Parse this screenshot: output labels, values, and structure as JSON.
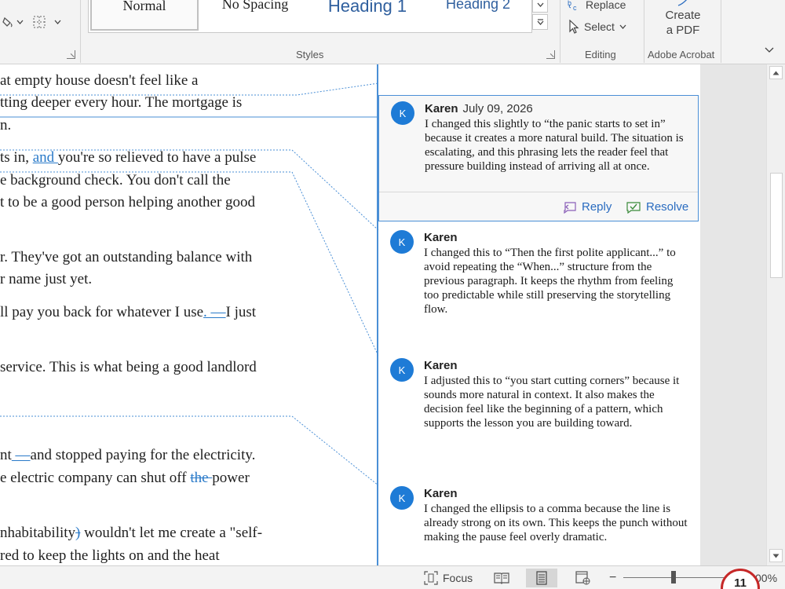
{
  "ribbon": {
    "styles_gallery": {
      "items": [
        "Normal",
        "No Spacing",
        "Heading 1",
        "Heading 2"
      ]
    },
    "groups": {
      "styles": "Styles",
      "editing": "Editing",
      "adobe": "Adobe Acrobat"
    },
    "editing": {
      "replace": "Replace",
      "select": "Select"
    },
    "adobe": {
      "create_pdf_line1": "Create",
      "create_pdf_line2": "a PDF"
    }
  },
  "document": {
    "lines": [
      {
        "parts": [
          {
            "t": "at empty house doesn't feel like a",
            "k": "n"
          }
        ]
      },
      {
        "parts": [
          {
            "t": "tting deeper every hour. The mortgage is",
            "k": "n"
          }
        ]
      },
      {
        "parts": [
          {
            "t": "n.",
            "k": "n"
          }
        ]
      },
      {
        "parts": [
          {
            "t": "ts in, ",
            "k": "n"
          },
          {
            "t": "and ",
            "k": "ins"
          },
          {
            "t": "you're so relieved to have a pulse",
            "k": "n"
          }
        ]
      },
      {
        "parts": [
          {
            "t": "e background check. You don't call the",
            "k": "n"
          }
        ]
      },
      {
        "parts": [
          {
            "t": "t to be a good person helping another good",
            "k": "n"
          }
        ]
      },
      {
        "parts": [
          {
            "t": "r. They've got an outstanding balance with",
            "k": "n"
          }
        ]
      },
      {
        "parts": [
          {
            "t": "r name just yet.",
            "k": "n"
          }
        ]
      },
      {
        "parts": [
          {
            "t": "ll pay you back for whatever I use",
            "k": "n"
          },
          {
            "t": ". —",
            "k": "ins"
          },
          {
            "t": "I just",
            "k": "n"
          }
        ]
      },
      {
        "parts": [
          {
            "t": "service. This is what being a good landlord",
            "k": "n"
          }
        ]
      },
      {
        "parts": [
          {
            "t": "nt",
            "k": "n"
          },
          {
            "t": " —",
            "k": "ins"
          },
          {
            "t": "and stopped paying for the electricity.",
            "k": "n"
          }
        ]
      },
      {
        "parts": [
          {
            "t": "e electric company can shut off ",
            "k": "n"
          },
          {
            "t": "the ",
            "k": "del"
          },
          {
            "t": "power",
            "k": "n"
          }
        ]
      },
      {
        "parts": [
          {
            "t": "nhabitability",
            "k": "n"
          },
          {
            "t": ")",
            "k": "del"
          },
          {
            "t": " wouldn't let me create a \"self-",
            "k": "n"
          }
        ]
      },
      {
        "parts": [
          {
            "t": "red to keep the lights on and the heat",
            "k": "n"
          }
        ]
      }
    ]
  },
  "comments": [
    {
      "initial": "K",
      "author": "Karen",
      "date": "July 09, 2026",
      "text": "I changed this slightly to “the panic starts to set in” because it creates a more natural build. The situation is escalating, and this phrasing lets the reader feel that pressure building instead of arriving all at once.",
      "reply_label": "Reply",
      "resolve_label": "Resolve"
    },
    {
      "initial": "K",
      "author": "Karen",
      "date": "",
      "text": "I changed this to “Then the first polite applicant...” to avoid repeating the “When...” structure from the previous paragraph. It keeps the rhythm from feeling too predictable while still preserving the storytelling flow."
    },
    {
      "initial": "K",
      "author": "Karen",
      "date": "",
      "text": "I adjusted this to “you start cutting corners” because it sounds more natural in context. It also makes the decision feel like the beginning of a pattern, which supports the lesson you are building toward."
    },
    {
      "initial": "K",
      "author": "Karen",
      "date": "",
      "text": "I changed the ellipsis to a comma because the line is already strong on its own. This keeps the punch without making the pause feel overly dramatic."
    }
  ],
  "statusbar": {
    "focus": "Focus",
    "zoom": "00%",
    "badge": "11"
  },
  "colors": {
    "accent": "#1e7bd6",
    "track_change": "#2a7ac9",
    "ribbon_bg": "#f3f3f3"
  }
}
